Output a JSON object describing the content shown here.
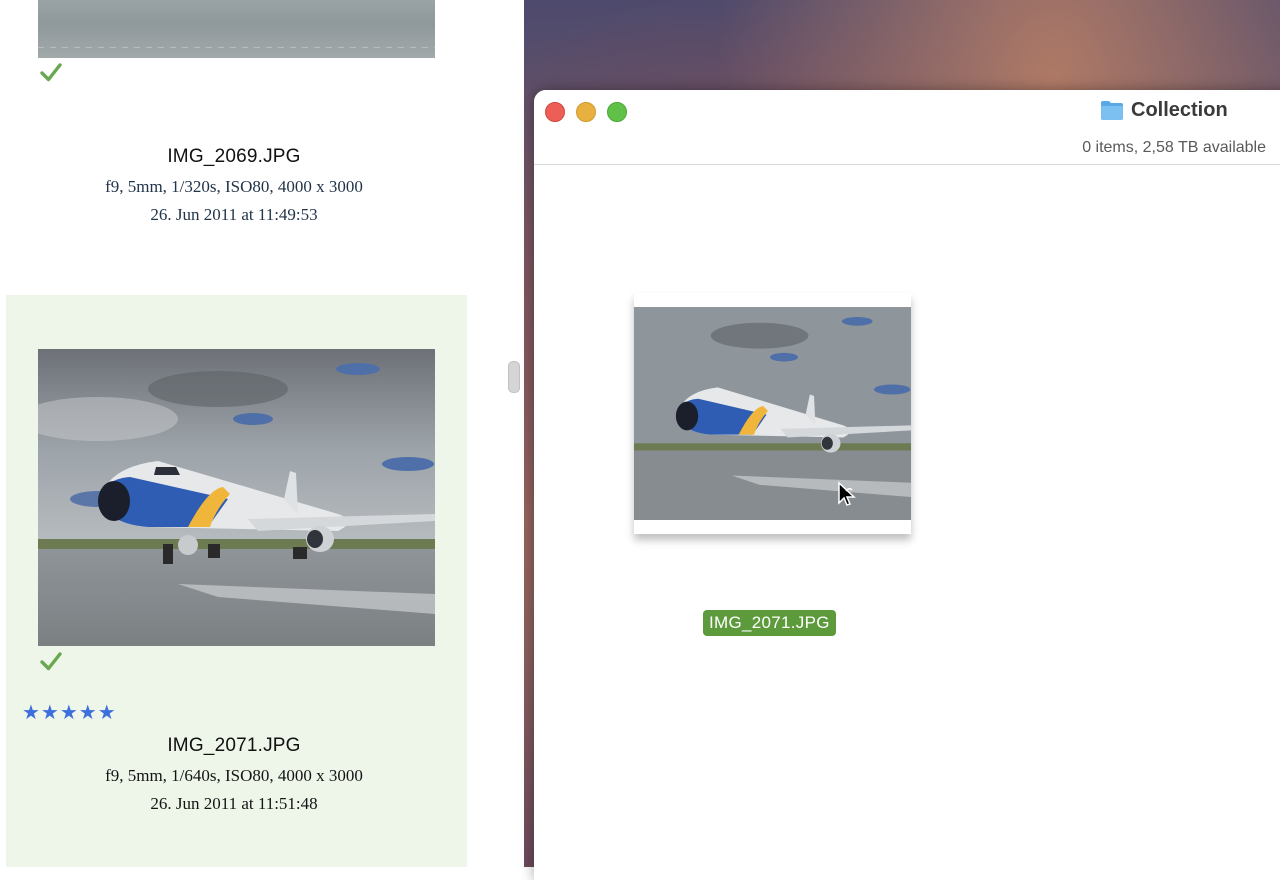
{
  "browser": {
    "photos": [
      {
        "file_name": "IMG_2069.JPG",
        "exif": "f9, 5mm, 1/320s, ISO80, 4000 x 3000",
        "date": "26. Jun 2011 at 11:49:53",
        "checked": true,
        "rating": 0
      },
      {
        "file_name": "IMG_2071.JPG",
        "exif": "f9, 5mm, 1/640s, ISO80, 4000 x 3000",
        "date": "26. Jun 2011 at 11:51:48",
        "checked": true,
        "rating": 5,
        "stars": "★★★★★",
        "selected": true
      }
    ]
  },
  "finder": {
    "title": "Collection",
    "status": "0 items, 2,58 TB available",
    "dragged_file": "IMG_2071.JPG"
  },
  "colors": {
    "check_green": "#6aa84f",
    "selection_bg": "#eef6ea",
    "star_blue": "#3d6fdc",
    "label_green": "#5c9a3c"
  },
  "icons": [
    "checkmark-icon",
    "star-icon",
    "folder-icon",
    "alias-cursor-icon"
  ]
}
